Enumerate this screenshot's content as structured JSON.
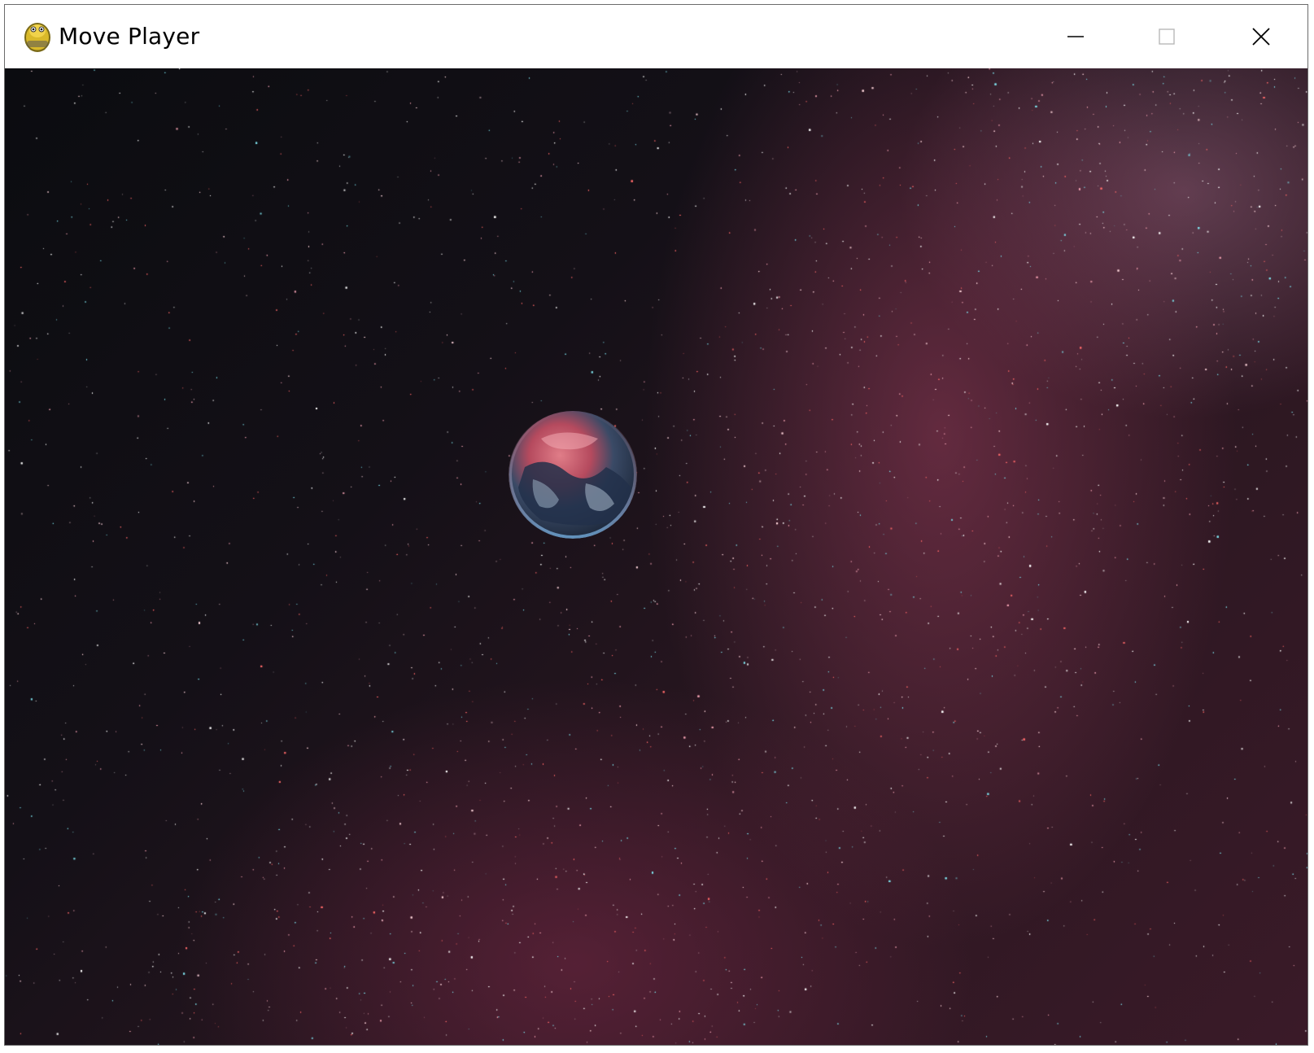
{
  "window": {
    "title": "Move Player",
    "app_icon": "pygame-snake-icon",
    "controls": {
      "minimize_icon": "minimize-icon",
      "maximize_icon": "maximize-icon",
      "close_icon": "close-icon"
    }
  },
  "scene": {
    "background": "starfield-milky-way",
    "player_sprite": "earth-planet",
    "colors": {
      "space_dark": "#0b0c10",
      "nebula_pink": "#963c5a",
      "planet_blue": "#3f6fa0",
      "planet_red": "#c8596a"
    }
  }
}
